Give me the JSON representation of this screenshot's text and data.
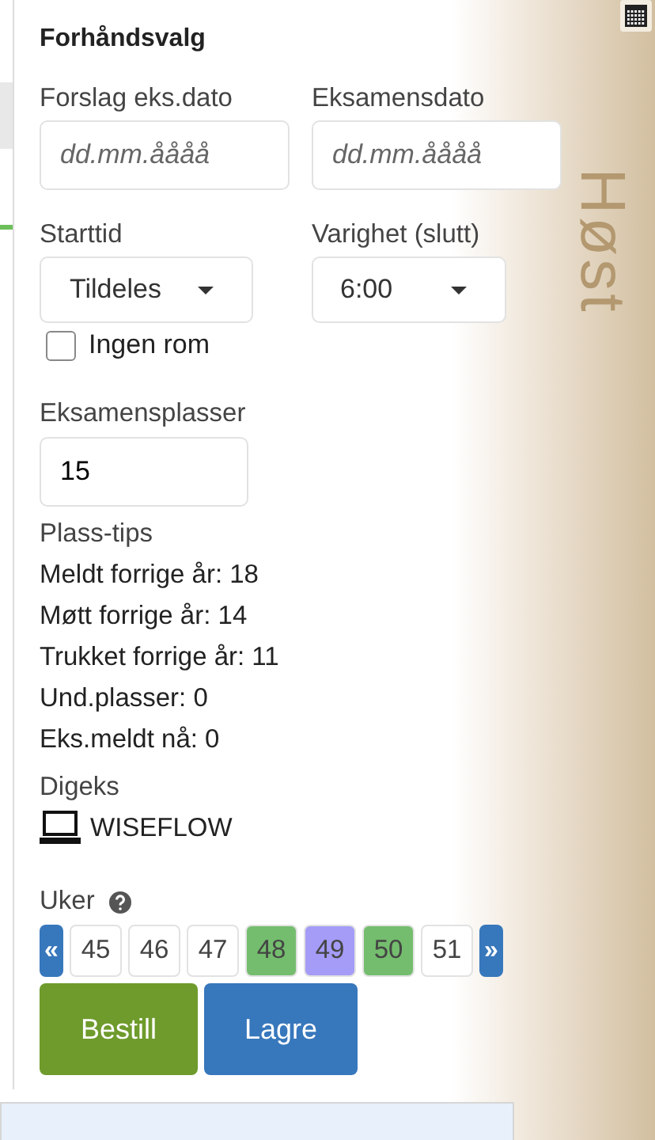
{
  "season_label": "Høst",
  "panel": {
    "title": "Forhåndsvalg",
    "date_fields": [
      {
        "label": "Forslag eks.dato",
        "placeholder": "dd.mm.åååå"
      },
      {
        "label": "Eksamensdato",
        "placeholder": "dd.mm.åååå"
      }
    ],
    "selects": [
      {
        "label": "Starttid",
        "value": "Tildeles"
      },
      {
        "label": "Varighet (slutt)",
        "value": "6:00"
      }
    ],
    "no_room": {
      "label": "Ingen rom",
      "checked": false
    },
    "seats": {
      "label": "Eksamensplasser",
      "value": "15"
    },
    "tips_heading": "Plass-tips",
    "tips": [
      "Meldt forrige år: 18",
      "Møtt forrige år: 14",
      "Trukket forrige år: 11",
      "Und.plasser: 0",
      "Eks.meldt nå: 0"
    ],
    "digeks_heading": "Digeks",
    "digeks_system": "WISEFLOW",
    "weeks_label": "Uker",
    "prev": "«",
    "next": "»",
    "weeks": [
      {
        "label": "45",
        "color": "#ffffff"
      },
      {
        "label": "46",
        "color": "#ffffff"
      },
      {
        "label": "47",
        "color": "#ffffff"
      },
      {
        "label": "48",
        "color": "#74bd6e"
      },
      {
        "label": "49",
        "color": "#a49cf7"
      },
      {
        "label": "50",
        "color": "#74bd6e"
      },
      {
        "label": "51",
        "color": "#ffffff"
      }
    ],
    "buttons": [
      {
        "label": "Bestill",
        "kind": "order"
      },
      {
        "label": "Lagre",
        "kind": "save"
      }
    ]
  }
}
